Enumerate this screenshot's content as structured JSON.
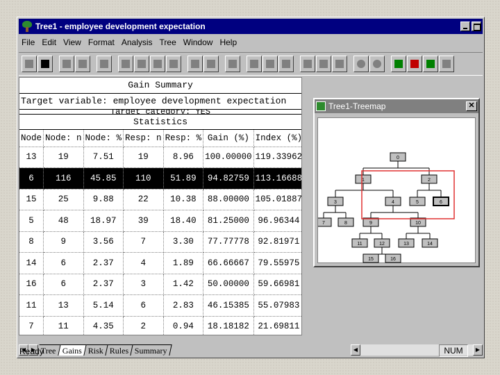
{
  "window": {
    "title": "Tree1 - employee development expectation"
  },
  "menu": [
    "File",
    "Edit",
    "View",
    "Format",
    "Analysis",
    "Tree",
    "Window",
    "Help"
  ],
  "gains": {
    "title": "Gain Summary",
    "target": "Target variable: employee development expectation",
    "category_partial": "Target category: YES",
    "stats_title": "Statistics",
    "columns": [
      "Node",
      "Node: n",
      "Node: %",
      "Resp: n",
      "Resp: %",
      "Gain (%)",
      "Index (%)"
    ],
    "rows": [
      [
        "13",
        "19",
        "7.51",
        "19",
        "8.96",
        "100.00000",
        "119.33962"
      ],
      [
        "6",
        "116",
        "45.85",
        "110",
        "51.89",
        "94.82759",
        "113.16688"
      ],
      [
        "15",
        "25",
        "9.88",
        "22",
        "10.38",
        "88.00000",
        "105.01887"
      ],
      [
        "5",
        "48",
        "18.97",
        "39",
        "18.40",
        "81.25000",
        "96.96344"
      ],
      [
        "8",
        "9",
        "3.56",
        "7",
        "3.30",
        "77.77778",
        "92.81971"
      ],
      [
        "14",
        "6",
        "2.37",
        "4",
        "1.89",
        "66.66667",
        "79.55975"
      ],
      [
        "16",
        "6",
        "2.37",
        "3",
        "1.42",
        "50.00000",
        "59.66981"
      ],
      [
        "11",
        "13",
        "5.14",
        "6",
        "2.83",
        "46.15385",
        "55.07983"
      ],
      [
        "7",
        "11",
        "4.35",
        "2",
        "0.94",
        "18.18182",
        "21.69811"
      ]
    ],
    "selected_row": 1
  },
  "treemap": {
    "title": "Tree1-Treemap",
    "selected_node": "6",
    "highlight_color": "#e03030"
  },
  "tabs": [
    "Tree",
    "Gains",
    "Risk",
    "Rules",
    "Summary"
  ],
  "active_tab": "Gains",
  "status": {
    "text": "Ready",
    "num": "NUM"
  }
}
